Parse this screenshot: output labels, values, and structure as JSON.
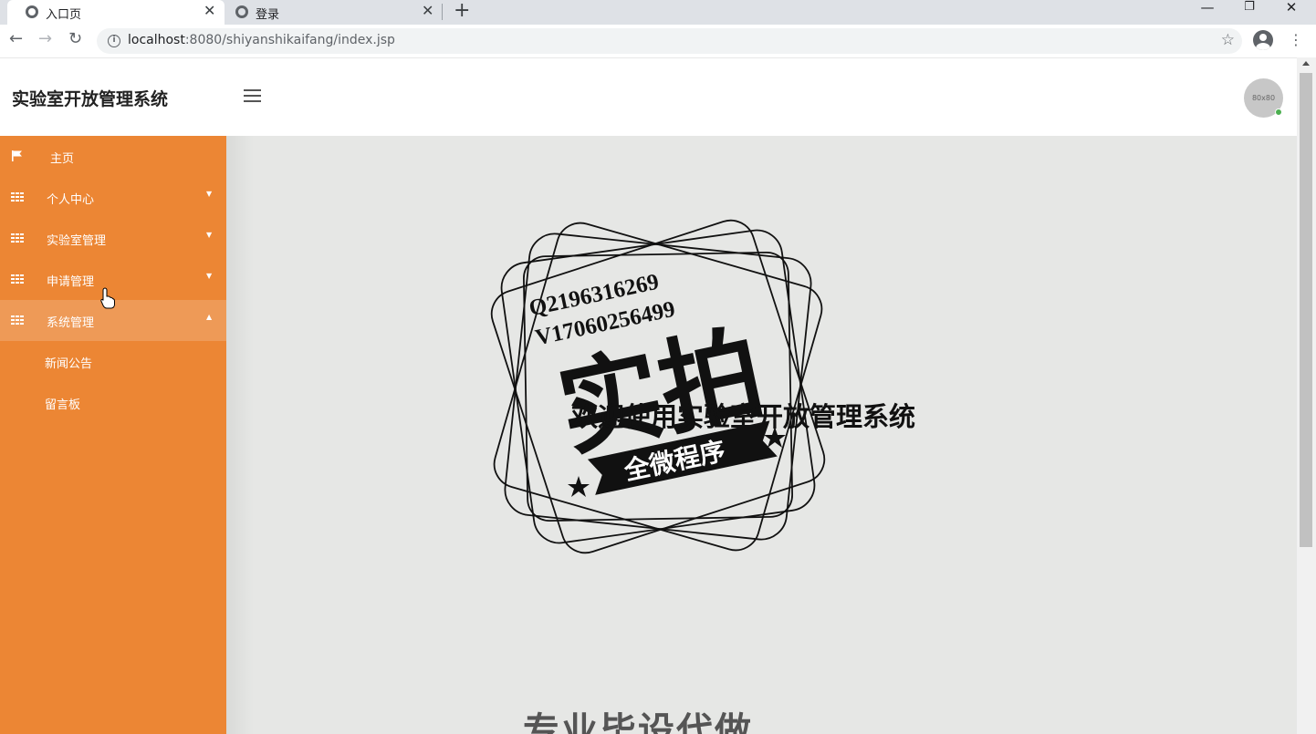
{
  "browser": {
    "tabs": [
      {
        "title": "入口页",
        "active": true
      },
      {
        "title": "登录",
        "active": false
      }
    ],
    "url_host": "localhost",
    "url_rest": ":8080/shiyanshikaifang/index.jsp",
    "window_controls": {
      "minimize": "—",
      "restore": "❐",
      "close": "✕"
    }
  },
  "header": {
    "app_title": "实验室开放管理系统",
    "avatar_text": "80x80"
  },
  "sidebar": {
    "items": [
      {
        "label": "主页",
        "icon": "flag-icon",
        "has_caret": false
      },
      {
        "label": "个人中心",
        "icon": "grid-icon",
        "has_caret": true,
        "expanded": false
      },
      {
        "label": "实验室管理",
        "icon": "grid-icon",
        "has_caret": true,
        "expanded": false
      },
      {
        "label": "申请管理",
        "icon": "grid-icon",
        "has_caret": true,
        "expanded": false
      },
      {
        "label": "系统管理",
        "icon": "grid-icon",
        "has_caret": true,
        "expanded": true
      }
    ],
    "subitems": [
      {
        "label": "新闻公告"
      },
      {
        "label": "留言板"
      }
    ]
  },
  "main": {
    "welcome_text": "欢迎使用实验室开放管理系统",
    "watermark": {
      "line1": "Q2196316269",
      "line2": "V17060256499",
      "big": "实拍",
      "banner": "全微程序"
    },
    "promo_text": "专业毕设代做"
  },
  "colors": {
    "sidebar": "#ec8634",
    "sidebar_open": "#ee9a57",
    "content_bg": "#e6e7e5"
  }
}
